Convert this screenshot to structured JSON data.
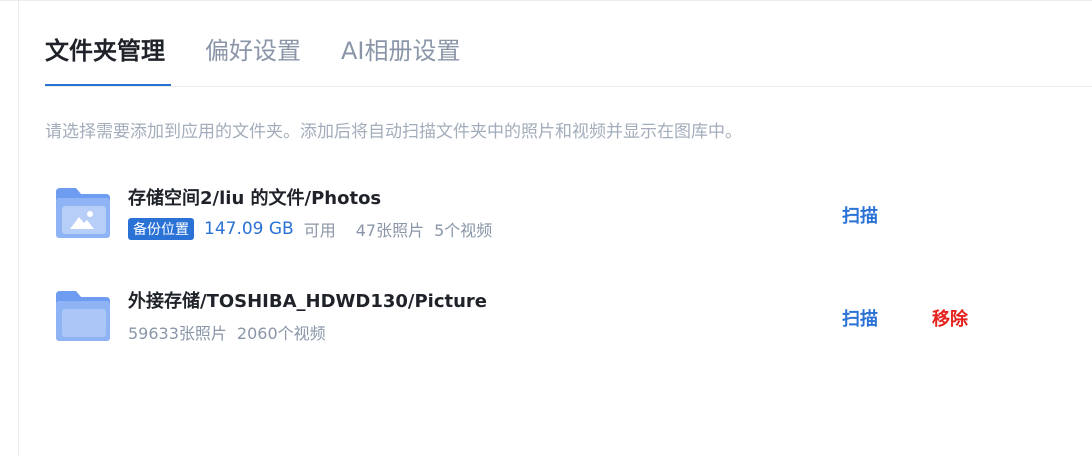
{
  "tabs": [
    {
      "label": "文件夹管理",
      "active": true
    },
    {
      "label": "偏好设置",
      "active": false
    },
    {
      "label": "AI相册设置",
      "active": false
    }
  ],
  "hint": "请选择需要添加到应用的文件夹。添加后将自动扫描文件夹中的照片和视频并显示在图库中。",
  "folders": [
    {
      "icon": "folder-image-icon",
      "path": "存储空间2/liu 的文件/Photos",
      "badge": "备份位置",
      "size": "147.09 GB",
      "available": "可用",
      "photos": "47张照片",
      "videos": "5个视频",
      "scan_label": "扫描"
    },
    {
      "icon": "folder-icon",
      "path": "外接存储/TOSHIBA_HDWD130/Picture",
      "photos": "59633张照片",
      "videos": "2060个视频",
      "scan_label": "扫描",
      "remove_label": "移除"
    }
  ],
  "colors": {
    "accent": "#2a72d6",
    "danger": "#e5231e",
    "muted": "#8a96a8",
    "folder_body": "#8fb4f5",
    "folder_tab": "#6d9cf0"
  }
}
